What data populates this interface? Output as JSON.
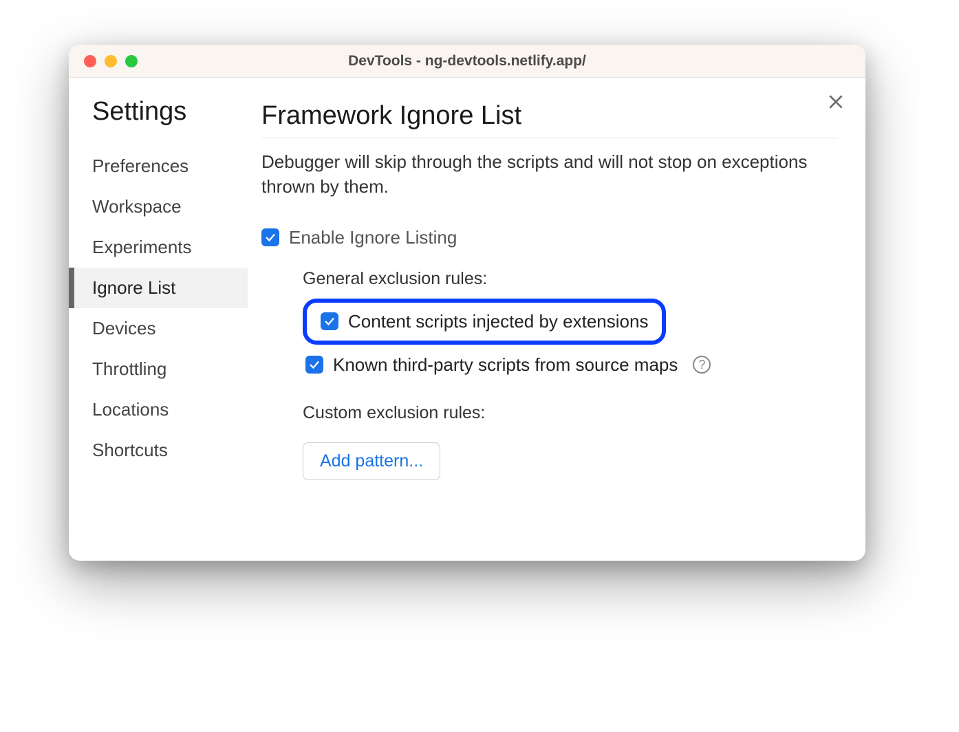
{
  "window": {
    "title": "DevTools - ng-devtools.netlify.app/"
  },
  "sidebar": {
    "title": "Settings",
    "items": [
      {
        "label": "Preferences",
        "active": false
      },
      {
        "label": "Workspace",
        "active": false
      },
      {
        "label": "Experiments",
        "active": false
      },
      {
        "label": "Ignore List",
        "active": true
      },
      {
        "label": "Devices",
        "active": false
      },
      {
        "label": "Throttling",
        "active": false
      },
      {
        "label": "Locations",
        "active": false
      },
      {
        "label": "Shortcuts",
        "active": false
      }
    ]
  },
  "main": {
    "title": "Framework Ignore List",
    "description": "Debugger will skip through the scripts and will not stop on exceptions thrown by them.",
    "enable_label": "Enable Ignore Listing",
    "enable_checked": true,
    "general_rules_label": "General exclusion rules:",
    "rule_content_scripts": {
      "label": "Content scripts injected by extensions",
      "checked": true,
      "highlighted": true
    },
    "rule_third_party": {
      "label": "Known third-party scripts from source maps",
      "checked": true,
      "has_help": true
    },
    "custom_rules_label": "Custom exclusion rules:",
    "add_pattern_label": "Add pattern..."
  }
}
